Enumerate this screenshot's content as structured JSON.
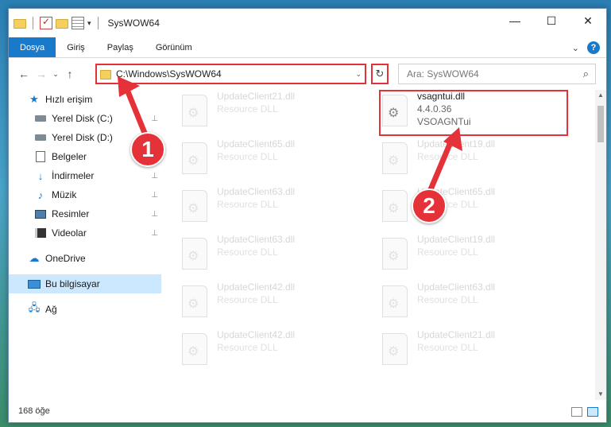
{
  "window": {
    "title": "SysWOW64",
    "minimize_glyph": "—",
    "maximize_glyph": "☐",
    "close_glyph": "✕"
  },
  "ribbon": {
    "tabs": [
      "Dosya",
      "Giriş",
      "Paylaş",
      "Görünüm"
    ],
    "expand_glyph": "⌄",
    "help_glyph": "?"
  },
  "nav": {
    "back_glyph": "←",
    "forward_glyph": "→",
    "recent_glyph": "⌄",
    "up_glyph": "↑",
    "address": "C:\\Windows\\SysWOW64",
    "address_dropdown_glyph": "⌄",
    "refresh_glyph": "↻",
    "search_placeholder": "Ara: SysWOW64",
    "search_glyph": "⌕"
  },
  "sidebar": {
    "quick_access": "Hızlı erişim",
    "items": [
      {
        "label": "Yerel Disk (C:)",
        "icon": "drive-icon",
        "pinned": true
      },
      {
        "label": "Yerel Disk (D:)",
        "icon": "drive-icon",
        "pinned": false
      },
      {
        "label": "Belgeler",
        "icon": "documents-icon",
        "pinned": true
      },
      {
        "label": "İndirmeler",
        "icon": "download-icon",
        "pinned": true
      },
      {
        "label": "Müzik",
        "icon": "music-icon",
        "pinned": true
      },
      {
        "label": "Resimler",
        "icon": "pictures-icon",
        "pinned": true
      },
      {
        "label": "Videolar",
        "icon": "video-icon",
        "pinned": true
      }
    ],
    "onedrive": "OneDrive",
    "this_pc": "Bu bilgisayar",
    "network": "Ağ",
    "pin_glyph": "📌"
  },
  "files": [
    {
      "name": "UpdateClient21.dll",
      "desc": "Resource DLL"
    },
    {
      "name": "vsagntui.dll",
      "desc": "4.4.0.36",
      "desc2": "VSOAGNTui"
    },
    {
      "name": "UpdateClient65.dll",
      "desc": "Resource DLL"
    },
    {
      "name": "UpdateClient19.dll",
      "desc": "Resource DLL"
    },
    {
      "name": "UpdateClient63.dll",
      "desc": "Resource DLL"
    },
    {
      "name": "UpdateClient65.dll",
      "desc": "Resource DLL"
    },
    {
      "name": "UpdateClient63.dll",
      "desc": "Resource DLL"
    },
    {
      "name": "UpdateClient19.dll",
      "desc": "Resource DLL"
    },
    {
      "name": "UpdateClient42.dll",
      "desc": "Resource DLL"
    },
    {
      "name": "UpdateClient63.dll",
      "desc": "Resource DLL"
    },
    {
      "name": "UpdateClient42.dll",
      "desc": "Resource DLL"
    },
    {
      "name": "UpdateClient21.dll",
      "desc": "Resource DLL"
    }
  ],
  "status": {
    "count": "168 öğe"
  },
  "callouts": {
    "one": "1",
    "two": "2"
  },
  "colors": {
    "accent": "#1979ca",
    "highlight": "#e53238"
  }
}
